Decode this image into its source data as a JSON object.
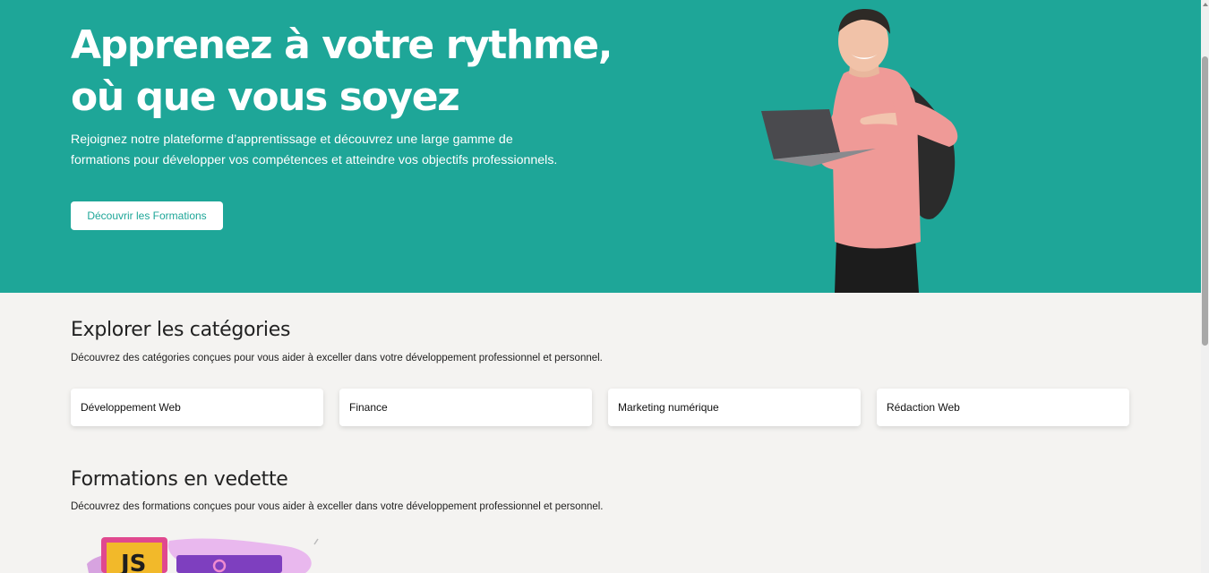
{
  "hero": {
    "title_line1": "Apprenez à votre rythme,",
    "title_line2": "où que vous soyez",
    "subtitle": "Rejoignez notre plateforme d’apprentissage et découvrez une large gamme de formations pour développer vos compétences et atteindre vos objectifs professionnels.",
    "cta_label": "Découvrir les Formations"
  },
  "categories": {
    "title": "Explorer les catégories",
    "description": "Découvrez des catégories conçues pour vous aider à exceller dans votre développement professionnel et personnel.",
    "items": [
      {
        "label": "Développement Web"
      },
      {
        "label": "Finance"
      },
      {
        "label": "Marketing numérique"
      },
      {
        "label": "Rédaction Web"
      }
    ]
  },
  "featured": {
    "title": "Formations en vedette",
    "description": "Découvrez des formations conçues pour vous aider à exceller dans votre développement professionnel et personnel.",
    "thumb_text": "JS"
  },
  "colors": {
    "primary": "#1ea698",
    "background": "#f4f3f1"
  }
}
